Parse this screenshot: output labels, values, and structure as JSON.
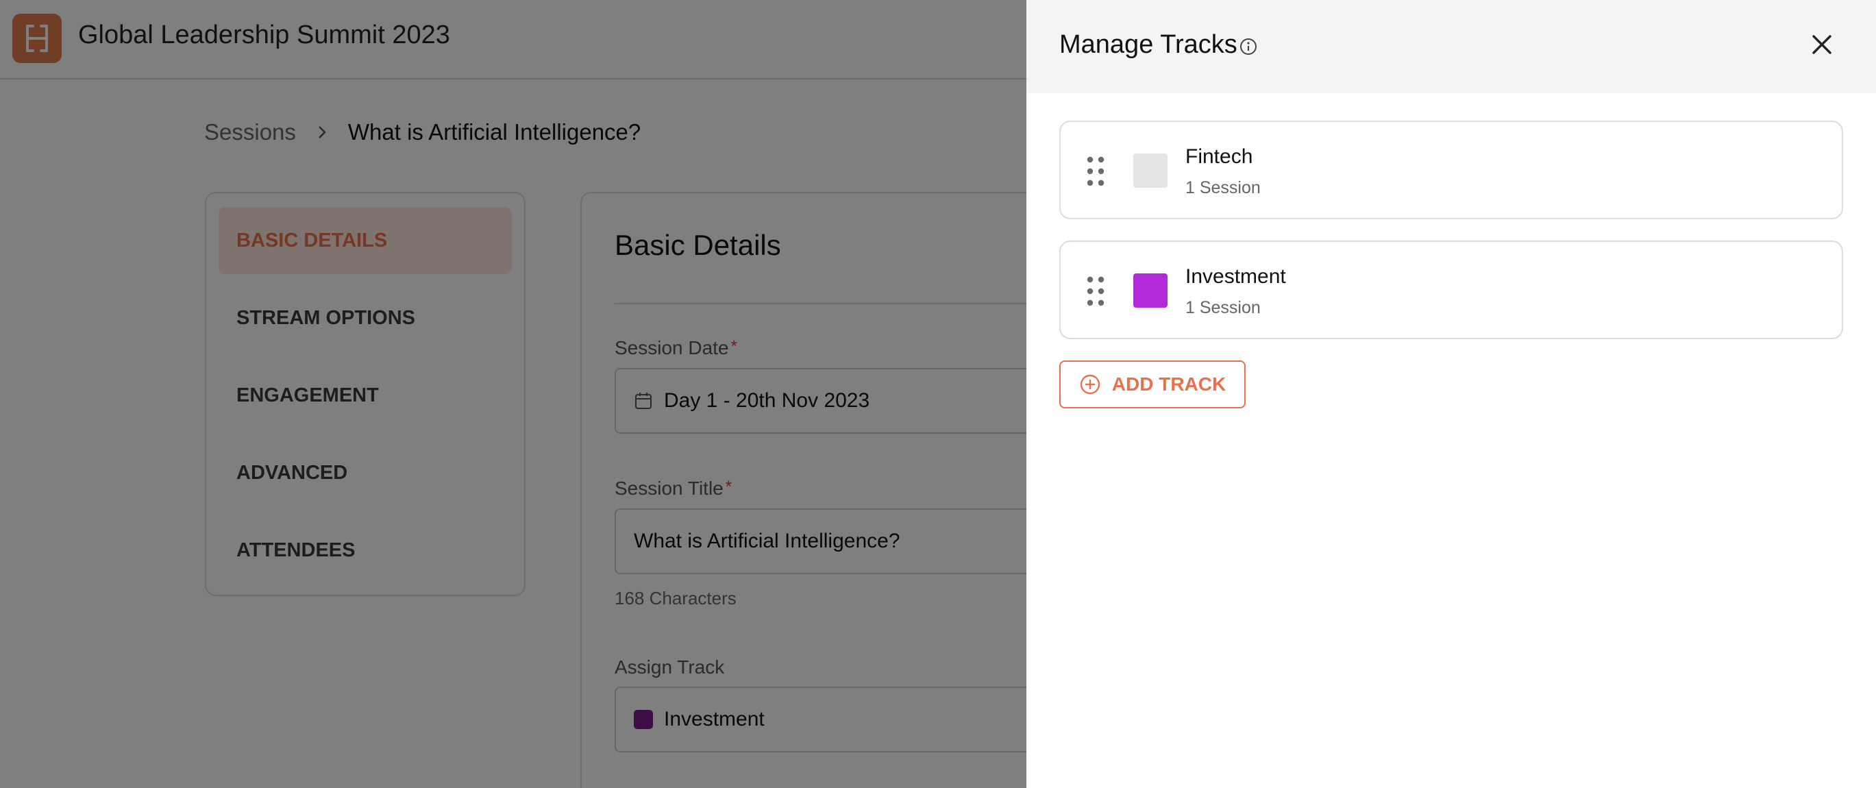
{
  "app": {
    "event_title": "Global Leadership Summit 2023",
    "logo_icon": "hubilo-logo-icon"
  },
  "breadcrumb": {
    "parent": "Sessions",
    "current": "What is Artificial Intelligence?"
  },
  "side_nav": {
    "items": [
      {
        "label": "BASIC DETAILS",
        "active": true
      },
      {
        "label": "STREAM OPTIONS",
        "active": false
      },
      {
        "label": "ENGAGEMENT",
        "active": false
      },
      {
        "label": "ADVANCED",
        "active": false
      },
      {
        "label": "ATTENDEES",
        "active": false
      }
    ]
  },
  "form": {
    "title": "Basic Details",
    "session_date": {
      "label": "Session Date",
      "required_mark": "*",
      "value": "Day 1 - 20th Nov 2023"
    },
    "session_title": {
      "label": "Session Title",
      "required_mark": "*",
      "value": "What is Artificial Intelligence?",
      "hint": "168 Characters"
    },
    "assign_track": {
      "label": "Assign Track",
      "value": "Investment",
      "color": "#7a1b8f"
    }
  },
  "drawer": {
    "title": "Manage Tracks",
    "tracks": [
      {
        "name": "Fintech",
        "count": "1 Session",
        "color": "#e4e4e4"
      },
      {
        "name": "Investment",
        "count": "1 Session",
        "color": "#b02ad7"
      }
    ],
    "add_button": "ADD TRACK"
  },
  "colors": {
    "accent": "#e9704d",
    "overlay": "rgba(0,0,0,0.5)"
  }
}
